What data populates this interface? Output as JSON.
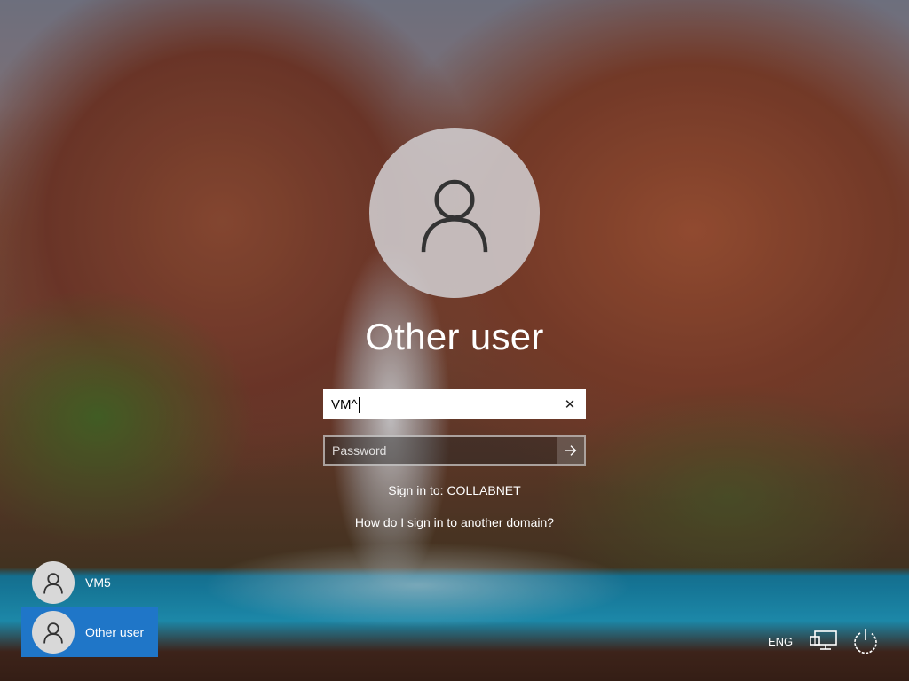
{
  "login": {
    "user_name": "Other user",
    "username_value": "VM^",
    "password_placeholder": "Password",
    "sign_in_to": "Sign in to: COLLABNET",
    "domain_help_link": "How do I sign in to another domain?"
  },
  "user_list": [
    {
      "label": "VM5",
      "selected": false
    },
    {
      "label": "Other user",
      "selected": true
    }
  ],
  "tray": {
    "language": "ENG",
    "network_icon": "network-icon",
    "power_icon": "power-icon"
  },
  "colors": {
    "selected_tile": "#1f76c8",
    "text": "#ffffff"
  }
}
